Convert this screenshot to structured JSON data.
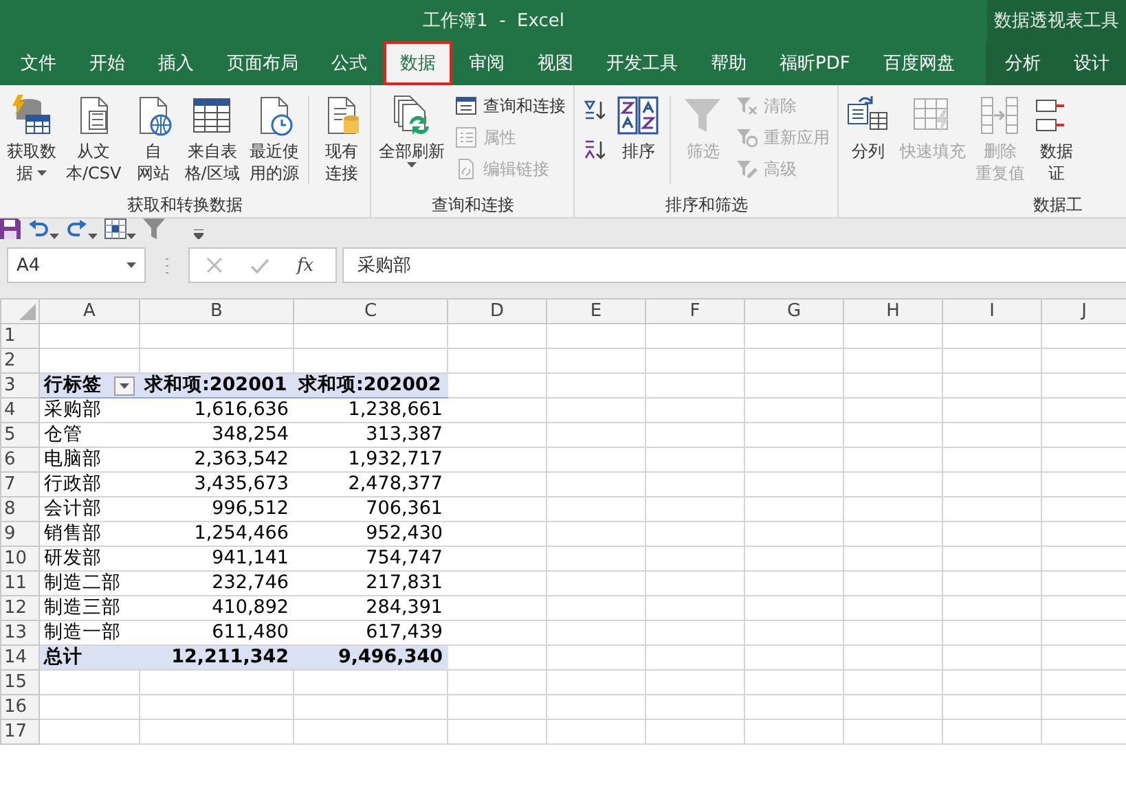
{
  "title_bar": {
    "title": "工作簿1  -  Excel",
    "context_tools": "数据透视表工具"
  },
  "tabs": [
    {
      "label": "文件",
      "selected": false,
      "kind": "standard",
      "annotated": false
    },
    {
      "label": "开始",
      "selected": false,
      "kind": "standard",
      "annotated": false
    },
    {
      "label": "插入",
      "selected": false,
      "kind": "standard",
      "annotated": false
    },
    {
      "label": "页面布局",
      "selected": false,
      "kind": "standard",
      "annotated": false
    },
    {
      "label": "公式",
      "selected": false,
      "kind": "standard",
      "annotated": false
    },
    {
      "label": "数据",
      "selected": true,
      "kind": "standard",
      "annotated": true
    },
    {
      "label": "审阅",
      "selected": false,
      "kind": "standard",
      "annotated": false
    },
    {
      "label": "视图",
      "selected": false,
      "kind": "standard",
      "annotated": false
    },
    {
      "label": "开发工具",
      "selected": false,
      "kind": "standard",
      "annotated": false
    },
    {
      "label": "帮助",
      "selected": false,
      "kind": "standard",
      "annotated": false
    },
    {
      "label": "福昕PDF",
      "selected": false,
      "kind": "standard",
      "annotated": false
    },
    {
      "label": "百度网盘",
      "selected": false,
      "kind": "standard",
      "annotated": false
    },
    {
      "label": "分析",
      "selected": false,
      "kind": "context",
      "annotated": false
    },
    {
      "label": "设计",
      "selected": false,
      "kind": "context",
      "annotated": false
    }
  ],
  "ribbon": {
    "groups": [
      {
        "label": "获取和转换数据",
        "items": [
          {
            "kind": "large",
            "lines": [
              "获取数",
              "据"
            ],
            "disabled": false,
            "dropdown": true
          },
          {
            "kind": "large",
            "lines": [
              "从文",
              "本/CSV"
            ],
            "disabled": false,
            "dropdown": false
          },
          {
            "kind": "large",
            "lines": [
              "自",
              "网站"
            ],
            "disabled": false,
            "dropdown": false
          },
          {
            "kind": "large",
            "lines": [
              "来自表",
              "格/区域"
            ],
            "disabled": false,
            "dropdown": false
          },
          {
            "kind": "large",
            "lines": [
              "最近使",
              "用的源"
            ],
            "disabled": false,
            "dropdown": false
          },
          {
            "kind": "separator"
          },
          {
            "kind": "large",
            "lines": [
              "现有",
              "连接"
            ],
            "disabled": false,
            "dropdown": false
          }
        ]
      },
      {
        "label": "查询和连接",
        "items": [
          {
            "kind": "large",
            "lines": [
              "全部刷新"
            ],
            "disabled": false,
            "dropdown": true
          },
          {
            "kind": "stack",
            "items": [
              {
                "label": "查询和连接",
                "disabled": false
              },
              {
                "label": "属性",
                "disabled": true
              },
              {
                "label": "编辑链接",
                "disabled": true
              }
            ]
          }
        ]
      },
      {
        "label": "排序和筛选",
        "items": [
          {
            "kind": "stack",
            "items": [
              {
                "disabled": false
              },
              {
                "disabled": false
              }
            ]
          },
          {
            "kind": "large",
            "lines": [
              "排序"
            ],
            "disabled": false,
            "dropdown": false
          },
          {
            "kind": "separator"
          },
          {
            "kind": "large",
            "lines": [
              "筛选"
            ],
            "disabled": true,
            "dropdown": false
          },
          {
            "kind": "stack",
            "items": [
              {
                "label": "清除",
                "disabled": true
              },
              {
                "label": "重新应用",
                "disabled": true
              },
              {
                "label": "高级",
                "disabled": true
              }
            ]
          }
        ]
      },
      {
        "label": "数据工",
        "items": [
          {
            "kind": "large",
            "lines": [
              "分列"
            ],
            "disabled": false,
            "dropdown": false
          },
          {
            "kind": "large",
            "lines": [
              "快速填充"
            ],
            "disabled": true,
            "dropdown": false
          },
          {
            "kind": "large",
            "lines": [
              "删除",
              "重复值"
            ],
            "disabled": true,
            "dropdown": false
          },
          {
            "kind": "large",
            "lines": [
              "数据",
              "证"
            ],
            "disabled": false,
            "dropdown": false
          }
        ]
      }
    ]
  },
  "formula_bar": {
    "name_box": "A4",
    "function_label": "fx",
    "formula": "采购部"
  },
  "sheet": {
    "columns": [
      "A",
      "B",
      "C",
      "D",
      "E",
      "F",
      "G",
      "H",
      "I",
      "J"
    ],
    "rows": [
      {
        "number": "1",
        "kind": "empty",
        "cells": []
      },
      {
        "number": "2",
        "kind": "empty",
        "cells": []
      },
      {
        "number": "3",
        "kind": "pivot_header",
        "cells": [
          "行标签",
          "求和项:202001",
          "求和项:202002"
        ]
      },
      {
        "number": "4",
        "kind": "pivot_row",
        "cells": [
          "采购部",
          "1,616,636",
          "1,238,661"
        ]
      },
      {
        "number": "5",
        "kind": "pivot_row",
        "cells": [
          "仓管",
          "348,254",
          "313,387"
        ]
      },
      {
        "number": "6",
        "kind": "pivot_row",
        "cells": [
          "电脑部",
          "2,363,542",
          "1,932,717"
        ]
      },
      {
        "number": "7",
        "kind": "pivot_row",
        "cells": [
          "行政部",
          "3,435,673",
          "2,478,377"
        ]
      },
      {
        "number": "8",
        "kind": "pivot_row",
        "cells": [
          "会计部",
          "996,512",
          "706,361"
        ]
      },
      {
        "number": "9",
        "kind": "pivot_row",
        "cells": [
          "销售部",
          "1,254,466",
          "952,430"
        ]
      },
      {
        "number": "10",
        "kind": "pivot_row",
        "cells": [
          "研发部",
          "941,141",
          "754,747"
        ]
      },
      {
        "number": "11",
        "kind": "pivot_row",
        "cells": [
          "制造二部",
          "232,746",
          "217,831"
        ]
      },
      {
        "number": "12",
        "kind": "pivot_row",
        "cells": [
          "制造三部",
          "410,892",
          "284,391"
        ]
      },
      {
        "number": "13",
        "kind": "pivot_row",
        "cells": [
          "制造一部",
          "611,480",
          "617,439"
        ]
      },
      {
        "number": "14",
        "kind": "pivot_total",
        "cells": [
          "总计",
          "12,211,342",
          "9,496,340"
        ]
      },
      {
        "number": "15",
        "kind": "empty",
        "cells": []
      },
      {
        "number": "16",
        "kind": "empty",
        "cells": []
      },
      {
        "number": "17",
        "kind": "empty",
        "cells": []
      }
    ]
  }
}
